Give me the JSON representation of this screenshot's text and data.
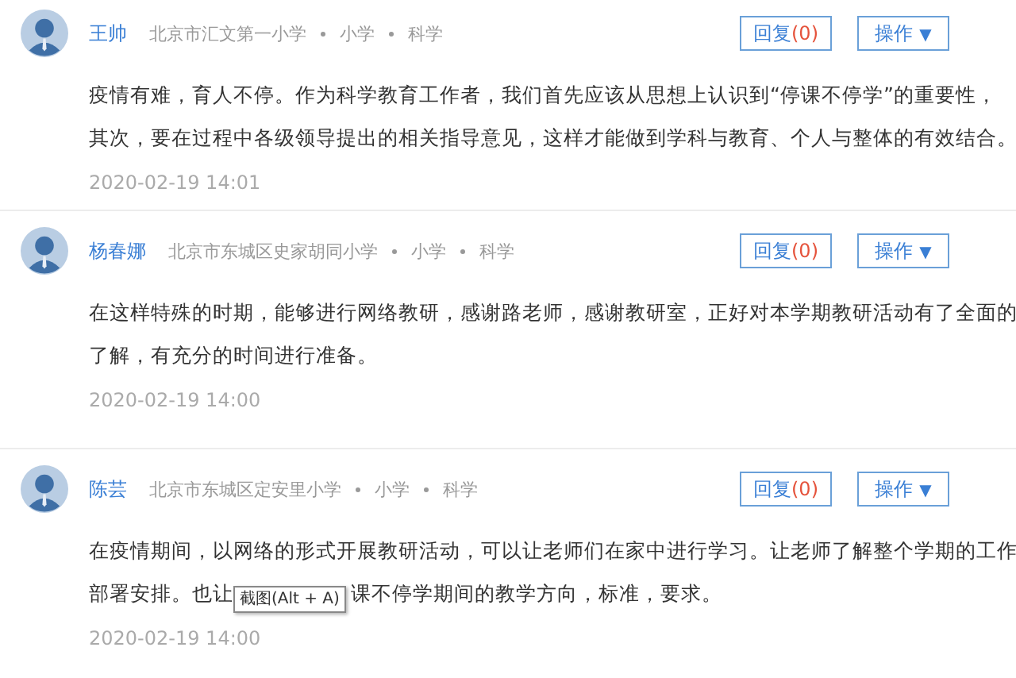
{
  "comments": [
    {
      "author": "王帅",
      "school": "北京市汇文第一小学",
      "level": "小学",
      "subject": "科学",
      "reply_label": "回复",
      "reply_count": "(0)",
      "action_label": "操作",
      "action_caret": "▼",
      "lines": [
        [
          "疫情有难，育人不停。作为科学教育工作者，我们首先应该从思想上认识到“停课不停学”的重要性，"
        ],
        [
          "其次，要在过程中各级领导提出的相关指导意见，这样才能做到学科与教育、个人与整体的有效结合。"
        ]
      ],
      "date": "2020-02-19 14:01"
    },
    {
      "author": "杨春娜",
      "school": "北京市东城区史家胡同小学",
      "level": "小学",
      "subject": "科学",
      "reply_label": "回复",
      "reply_count": "(0)",
      "action_label": "操作",
      "action_caret": "▼",
      "lines": [
        [
          "在这样特殊的时期，能够进行网络教研，感谢路老师，感谢教研室，正好对本学期教研活动有了全面的"
        ],
        [
          "了解，有充分的时间进行准备。"
        ]
      ],
      "date": "2020-02-19 14:00"
    },
    {
      "author": "陈芸",
      "school": "北京市东城区定安里小学",
      "level": "小学",
      "subject": "科学",
      "reply_label": "回复",
      "reply_count": "(0)",
      "action_label": "操作",
      "action_caret": "▼",
      "lines": [
        [
          "在疫情期间，以网络的形式开展教研活动，可以让老师们在家中进行学习。让老师了解整个学期的工作"
        ],
        [
          "部署安排。也让",
          "课不停学期间的教学方向，标准，要求。"
        ]
      ],
      "tooltip": "截图(Alt + A)",
      "date": "2020-02-19 14:00"
    }
  ]
}
